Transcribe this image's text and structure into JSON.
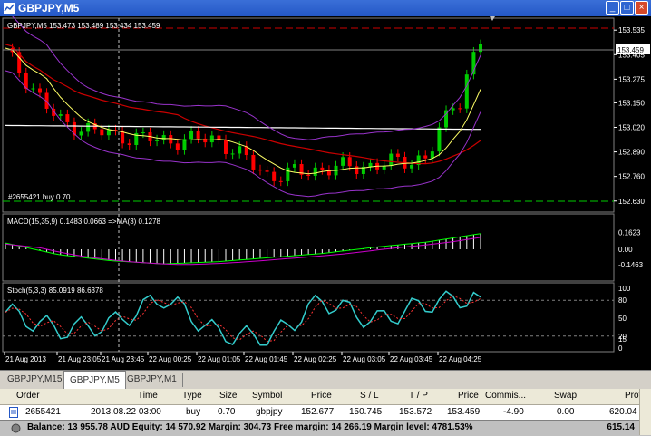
{
  "window": {
    "title": "GBPJPY,M5"
  },
  "chart": {
    "header": "GBPJPY,M5  153.473 153.489 153.434 153.459",
    "order_label": "#2655421 buy 0.70",
    "current_price": "153.459",
    "price_ticks": [
      "153.535",
      "153.405",
      "153.275",
      "153.150",
      "153.020",
      "152.890",
      "152.760",
      "152.630"
    ],
    "macd_label": "MACD(15,35,9) 0.1483 0.0663  =>MA(3) 0.1278",
    "macd_ticks": [
      "0.1623",
      "0.00",
      "-0.1463"
    ],
    "stoch_label": "Stoch(5,3,3) 85.0919 86.6378",
    "stoch_ticks": [
      "100",
      "80",
      "50",
      "20",
      "0"
    ],
    "stoch_extra_ticks": [
      "15"
    ],
    "time_ticks": [
      "21 Aug 2013",
      "21 Aug 23:05",
      "21 Aug 23:45",
      "22 Aug 00:25",
      "22 Aug 01:05",
      "22 Aug 01:45",
      "22 Aug 02:25",
      "22 Aug 03:05",
      "22 Aug 03:45",
      "22 Aug 04:25"
    ]
  },
  "tabs": [
    "GBPJPY,M15",
    "GBPJPY,M5",
    "GBPJPY,M1"
  ],
  "active_tab": 1,
  "terminal": {
    "columns": [
      "Order",
      "Time",
      "Type",
      "Size",
      "Symbol",
      "Price",
      "S / L",
      "T / P",
      "Price",
      "Commis...",
      "Swap",
      "Profit"
    ],
    "row": {
      "order": "2655421",
      "time": "2013.08.22 03:00",
      "type": "buy",
      "size": "0.70",
      "symbol": "gbpjpy",
      "price": "152.677",
      "sl": "150.745",
      "tp": "153.572",
      "cur_price": "153.459",
      "commission": "-4.90",
      "swap": "0.00",
      "profit": "620.04"
    },
    "balance_text": "Balance: 13 955.78 AUD  Equity: 14 570.92  Margin: 304.73  Free margin: 14 266.19  Margin level: 4781.53%",
    "total_profit": "615.14"
  },
  "chart_data": {
    "type": "line",
    "x": [
      "21 Aug 2013",
      "21 Aug 23:05",
      "21 Aug 23:45",
      "22 Aug 00:25",
      "22 Aug 01:05",
      "22 Aug 01:45",
      "22 Aug 02:25",
      "22 Aug 03:05",
      "22 Aug 03:45",
      "22 Aug 04:25"
    ],
    "candles_close": [
      153.42,
      153.05,
      152.98,
      152.95,
      152.96,
      152.76,
      152.8,
      152.82,
      152.86,
      153.46
    ],
    "stoch_values": [
      60,
      30,
      40,
      85,
      25,
      15,
      80,
      45,
      75,
      87
    ],
    "macd_hist": [
      0.06,
      -0.05,
      -0.11,
      -0.14,
      -0.12,
      -0.08,
      -0.04,
      0.02,
      0.07,
      0.15
    ],
    "ylim": [
      152.63,
      153.535
    ],
    "colors": {
      "bull": "#00cc00",
      "bear": "#ff0000",
      "bb": "#9933cc",
      "ma_red": "#cc0000",
      "ma_white": "#ffffff",
      "ma_yellow": "#ffff66",
      "stoch": "#33cccc"
    }
  }
}
